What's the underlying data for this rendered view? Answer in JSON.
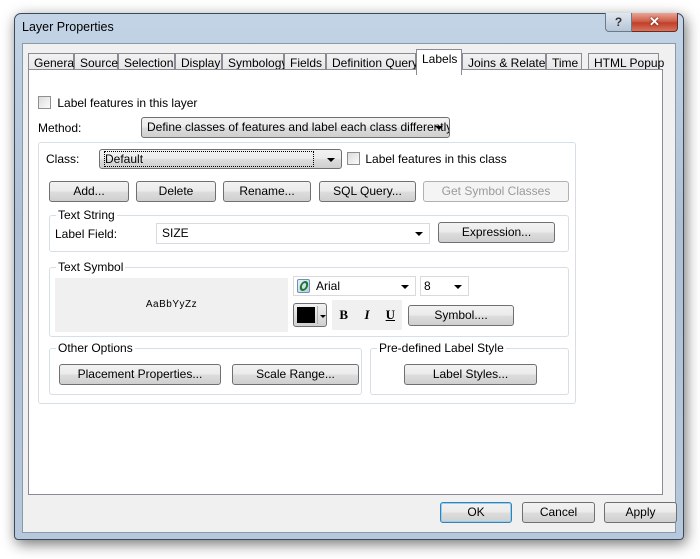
{
  "window": {
    "title": "Layer Properties",
    "help_glyph": "?",
    "close_glyph": "✕"
  },
  "tabs": [
    {
      "label": "General",
      "active": false
    },
    {
      "label": "Source",
      "active": false
    },
    {
      "label": "Selection",
      "active": false
    },
    {
      "label": "Display",
      "active": false
    },
    {
      "label": "Symbology",
      "active": false
    },
    {
      "label": "Fields",
      "active": false
    },
    {
      "label": "Definition Query",
      "active": false
    },
    {
      "label": "Labels",
      "active": true
    },
    {
      "label": "Joins & Relates",
      "active": false
    },
    {
      "label": "Time",
      "active": false
    },
    {
      "label": "HTML Popup",
      "active": false
    }
  ],
  "labels_tab": {
    "label_layer_checkbox": {
      "label": "Label features in this layer",
      "checked": false
    },
    "method": {
      "label": "Method:",
      "value": "Define classes of features and label each class differently."
    },
    "class": {
      "label": "Class:",
      "value": "Default",
      "label_class_checkbox": {
        "label": "Label features in this class",
        "checked": false
      }
    },
    "class_buttons": {
      "add": "Add...",
      "delete": "Delete",
      "rename": "Rename...",
      "sql_query": "SQL Query...",
      "get_symbol_classes": "Get Symbol Classes"
    },
    "text_string": {
      "title": "Text String",
      "label_field_label": "Label Field:",
      "label_field_value": "SIZE",
      "expression_button": "Expression..."
    },
    "text_symbol": {
      "title": "Text Symbol",
      "preview_text": "AaBbYyZz",
      "font": "Arial",
      "font_icon": "opentype-font-icon",
      "size": "8",
      "color": "#000000",
      "bold": "B",
      "italic": "I",
      "underline": "U",
      "symbol_button": "Symbol...."
    },
    "other_options": {
      "title": "Other Options",
      "placement_button": "Placement Properties...",
      "scale_range_button": "Scale Range..."
    },
    "predefined_style": {
      "title": "Pre-defined Label Style",
      "label_styles_button": "Label Styles..."
    }
  },
  "footer": {
    "ok": "OK",
    "cancel": "Cancel",
    "apply": "Apply"
  }
}
